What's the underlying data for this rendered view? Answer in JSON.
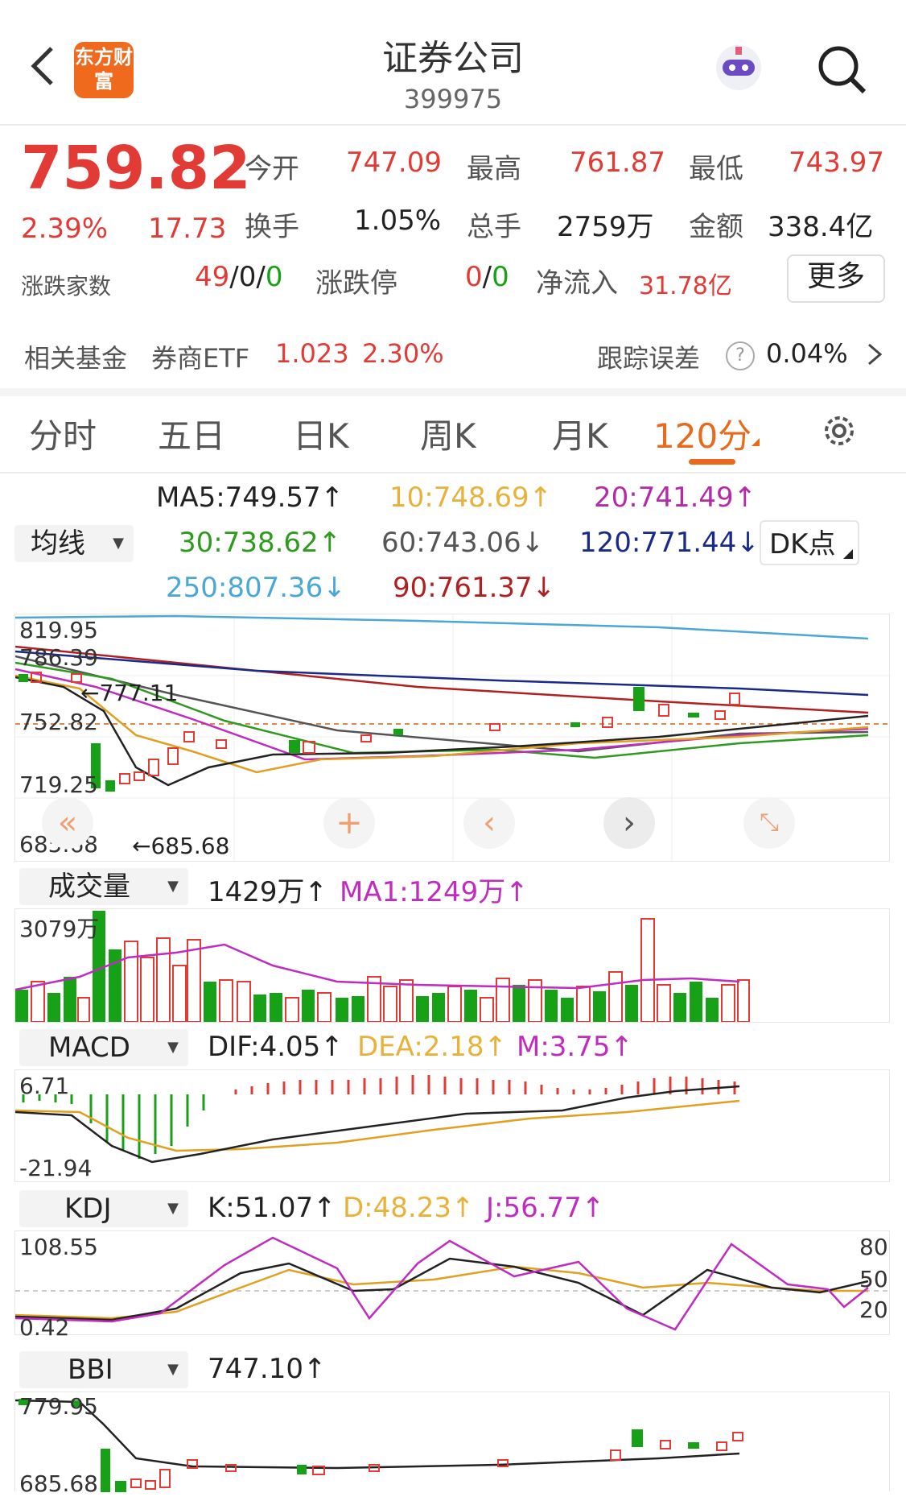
{
  "header": {
    "title": "证券公司",
    "code": "399975",
    "logo_text": "东方财富",
    "back_icon": "chevron-left-icon",
    "robot_icon": "robot-assistant-icon",
    "search_icon": "search-icon"
  },
  "quote": {
    "price": "759.82",
    "change_pct": "2.39%",
    "change_amt": "17.73",
    "open_label": "今开",
    "open": "747.09",
    "high_label": "最高",
    "high": "761.87",
    "low_label": "最低",
    "low": "743.97",
    "turnover_label": "换手",
    "turnover": "1.05%",
    "volume_label": "总手",
    "volume": "2759万",
    "amount_label": "金额",
    "amount": "338.4亿",
    "breadth_label": "涨跌家数",
    "breadth_up": "49",
    "sep1": "/",
    "breadth_flat": "0",
    "sep2": "/",
    "breadth_down": "0",
    "limit_label": "涨跌停",
    "limit_up": "0",
    "sep3": "/",
    "limit_down": "0",
    "inflow_label": "净流入",
    "inflow": "31.78亿",
    "more_button": "更多"
  },
  "fund": {
    "label": "相关基金",
    "name": "券商ETF",
    "price": "1.023",
    "pct": "2.30%",
    "tracking_label": "跟踪误差",
    "help_icon": "question-circle-icon",
    "tracking": "0.04%",
    "arrow_icon": "chevron-right-icon"
  },
  "tabs": [
    "分时",
    "五日",
    "日K",
    "周K",
    "月K",
    "120分"
  ],
  "active_tab": "120分",
  "settings_icon": "gear-icon",
  "ma": {
    "selector": "均线",
    "ma5": "MA5:749.57↑",
    "ma10": "10:748.69↑",
    "ma20": "20:741.49↑",
    "ma30": "30:738.62↑",
    "ma60": "60:743.06↓",
    "ma120": "120:771.44↓",
    "ma250": "250:807.36↓",
    "ma90": "90:761.37↓",
    "dk_button": "DK点"
  },
  "main_chart": {
    "y_labels": [
      "819.95",
      "786.39",
      "752.82",
      "719.25",
      "685.68"
    ],
    "max_marker": "←777.11",
    "min_marker": "←685.68",
    "controls": [
      "rewind-icon",
      "zoom-in-icon",
      "prev-icon",
      "next-icon",
      "fullscreen-icon"
    ],
    "colors": {
      "up": "#e23b36",
      "down": "#17a116",
      "ma5": "#222222",
      "ma10": "#e0a020",
      "ma20": "#c02cc0",
      "ma30": "#2e9a1e",
      "ma60": "#555555",
      "ma120": "#1a2a8a",
      "ma250": "#4aa7d6",
      "ma90": "#b02020"
    }
  },
  "volume": {
    "selector": "成交量",
    "value": "1429万↑",
    "ma1": "MA1:1249万↑",
    "max_label": "3079万"
  },
  "macd": {
    "selector": "MACD",
    "dif": "DIF:4.05↑",
    "dea": "DEA:2.18↑",
    "m": "M:3.75↑",
    "y_top": "6.71",
    "y_bottom": "-21.94"
  },
  "kdj": {
    "selector": "KDJ",
    "k": "K:51.07↑",
    "d": "D:48.23↑",
    "j": "J:56.77↑",
    "y_top": "108.55",
    "y_bottom": "0.42",
    "right_labels": [
      "80",
      "50",
      "20"
    ]
  },
  "bbi": {
    "selector": "BBI",
    "value": "747.10↑",
    "y_top": "779.95",
    "y_bottom": "685.68"
  }
}
